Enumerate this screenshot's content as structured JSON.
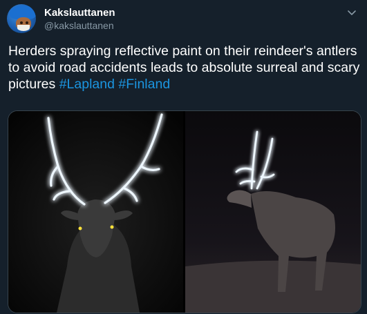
{
  "tweet": {
    "author": {
      "display_name": "Kakslauttanen",
      "handle": "@kakslauttanen"
    },
    "text_main": "Herders spraying reflective paint on their reindeer's antlers to avoid road accidents leads to absolute surreal and scary pictures ",
    "hashtags": [
      "#Lapland",
      "#Finland"
    ],
    "icons": {
      "menu": "chevron-down-icon"
    },
    "colors": {
      "background": "#15202b",
      "hashtag": "#1b95e0",
      "secondary_text": "#8899a6"
    }
  }
}
